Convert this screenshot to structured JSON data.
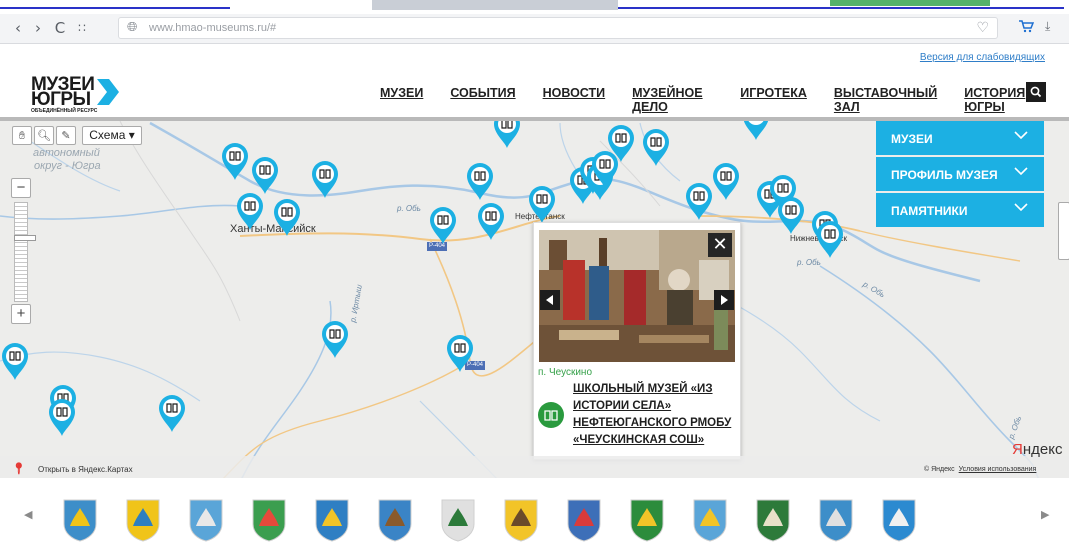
{
  "browser": {
    "url": "www.hmao-museums.ru/#",
    "back_icon": "back-icon",
    "forward_icon": "forward-icon",
    "reload_icon": "reload-icon",
    "apps_icon": "grid-icon"
  },
  "header": {
    "accessibility_link": "Версия для слабовидящих",
    "logo_line1": "МУЗЕИ",
    "logo_line2": "ЮГРЫ",
    "logo_line3": "ОБЪЕДИНЁННЫЙ РЕСУРС",
    "menu": [
      "МУЗЕИ",
      "СОБЫТИЯ",
      "НОВОСТИ",
      "МУЗЕЙНОЕ ДЕЛО",
      "ИГРОТЕКА",
      "ВЫСТАВОЧНЫЙ ЗАЛ",
      "ИСТОРИЯ ЮГРЫ"
    ],
    "accent_color": "#1cb0e3"
  },
  "map": {
    "scheme_label": "Схема ▾",
    "zoom_in": "+",
    "zoom_out": "−",
    "region_label_1": "автономный",
    "region_label_2": "округ - Югра",
    "city_khanty": "Ханты-Мансийск",
    "city_nefteyugansk": "Нефтеюганск",
    "city_nizhnevartovsk": "Нижневартовск",
    "river_ob_1": "р. Обь",
    "river_ob_2": "р. Обь",
    "river_ob_3": "р. Обь",
    "river_ob_4": "р. Обь",
    "river_irtysh": "р. Иртыш",
    "road_1": "Р-404",
    "road_2": "Р-404",
    "open_in_yandex": "Открыть в Яндекс.Картах",
    "yandex_logo_y": "Я",
    "yandex_logo_rest": "ндекс",
    "copyright": "© Яндекс",
    "terms": "Условия использования",
    "marker_color": "#1cb0e3"
  },
  "accordion": [
    "МУЗЕИ",
    "ПРОФИЛЬ МУЗЕЯ",
    "ПАМЯТНИКИ"
  ],
  "popup": {
    "place": "п. Чеускино",
    "title": "ШКОЛЬНЫЙ МУЗЕЙ «ИЗ ИСТОРИИ СЕЛА» НЕФТЕЮГАНСКОГО РМОБУ «ЧЕУСКИНСКАЯ СОШ»",
    "close": "✕",
    "category_color": "#2a9a3e"
  },
  "carousel": {
    "prev": "◀",
    "next": "▶",
    "crest_count": 14
  }
}
